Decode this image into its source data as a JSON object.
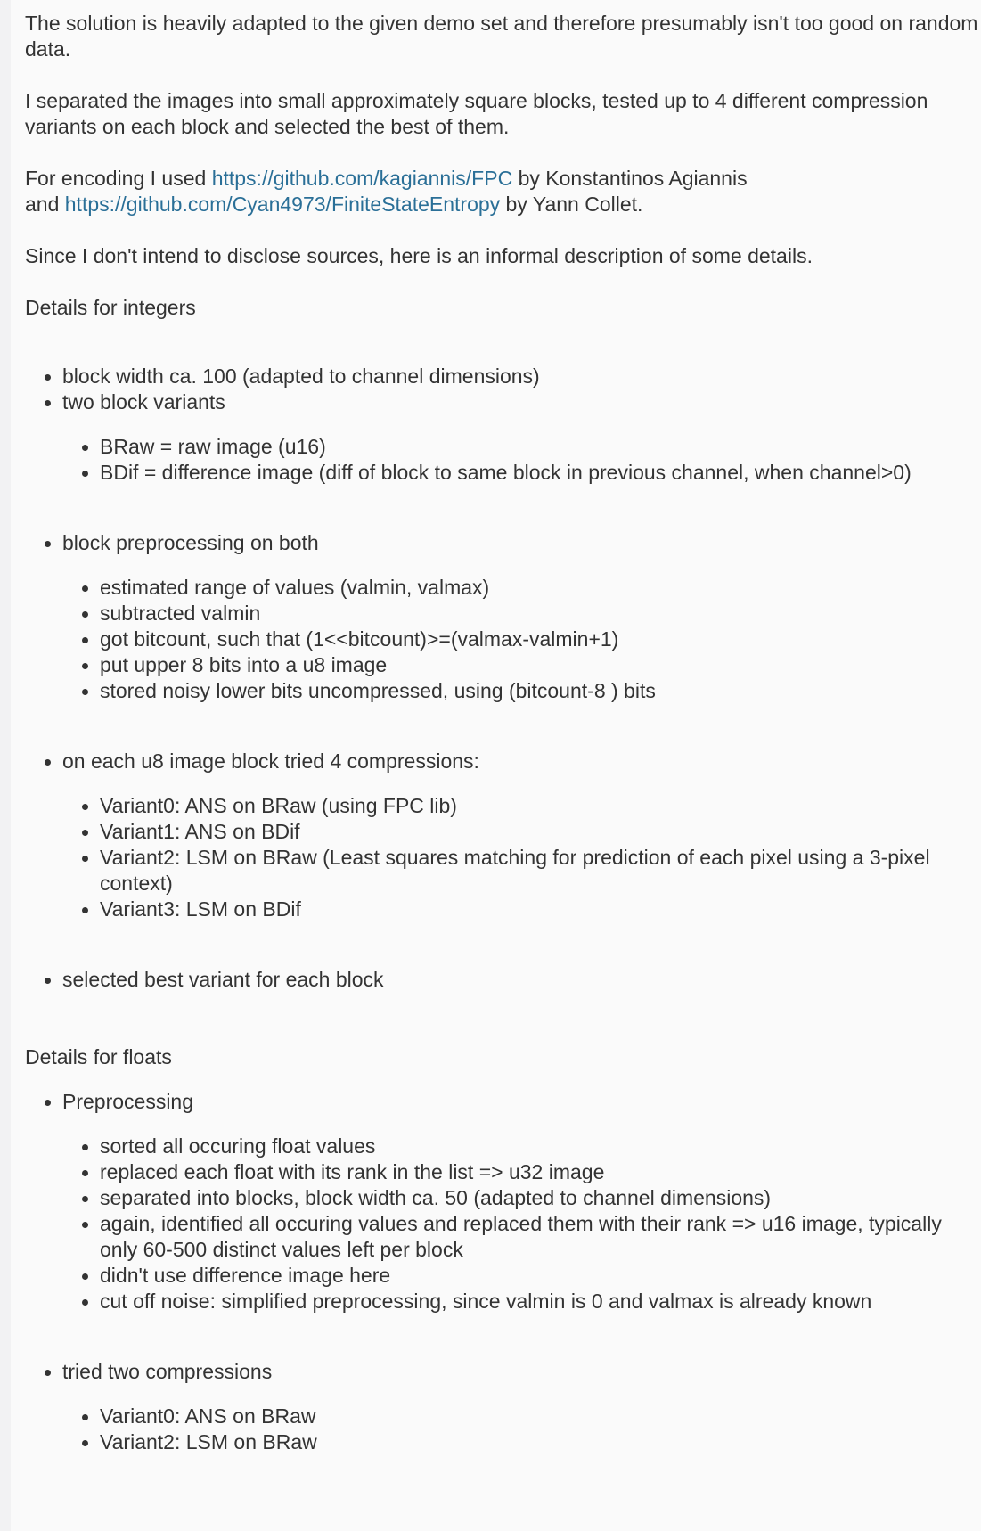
{
  "intro": {
    "p1": "The solution is heavily adapted to the given demo set and therefore presumably isn't too good on random data.",
    "p2": "I separated the images into small approximately square blocks, tested up to 4 different compression variants on each block and selected the best of them.",
    "p3": {
      "prefix": "For encoding I used ",
      "link1": "https://github.com/kagiannis/FPC",
      "mid": " by Konstantinos Agiannis",
      "and": "and ",
      "link2": "https://github.com/Cyan4973/FiniteStateEntropy",
      "suffix": " by Yann Collet."
    },
    "p4": "Since I don't intend to disclose sources, here is an informal description of some details."
  },
  "integers": {
    "heading": "Details for integers",
    "items": [
      {
        "label": "block width ca. 100 (adapted to channel dimensions)"
      },
      {
        "label": "two block variants",
        "sub": [
          "BRaw = raw image (u16)",
          "BDif = difference image (diff of block to same block in previous channel, when channel>0)"
        ]
      },
      {
        "label": "block preprocessing on both",
        "sub": [
          "estimated range of values (valmin, valmax)",
          "subtracted valmin",
          "got bitcount, such that (1<<bitcount)>=(valmax-valmin+1)",
          "put upper 8 bits into a u8 image",
          "stored noisy lower bits uncompressed, using (bitcount-8 ) bits"
        ]
      },
      {
        "label": "on each u8 image block tried 4 compressions:",
        "sub": [
          "Variant0: ANS on BRaw (using FPC lib)",
          "Variant1: ANS on BDif",
          "Variant2: LSM on BRaw (Least squares matching for prediction of each pixel using a 3-pixel context)",
          "Variant3: LSM on BDif"
        ]
      },
      {
        "label": "selected best variant for each block"
      }
    ]
  },
  "floats": {
    "heading": "Details for floats",
    "items": [
      {
        "label": "Preprocessing",
        "sub": [
          "sorted all occuring float values",
          "replaced each float with its rank in the list => u32 image",
          "separated into blocks, block width ca. 50 (adapted to channel dimensions)",
          "again, identified all occuring values and replaced them with their rank => u16 image, typically only 60-500 distinct values left per block",
          "didn't use difference image here",
          "cut off noise: simplified preprocessing, since valmin is 0 and valmax is already known"
        ]
      },
      {
        "label": "tried two compressions",
        "sub": [
          "Variant0: ANS on BRaw",
          "Variant2: LSM on BRaw"
        ]
      }
    ]
  }
}
